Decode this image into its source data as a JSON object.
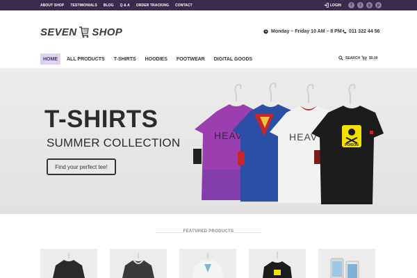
{
  "topbar": {
    "links": [
      "ABOUT SHOP",
      "TESTIMONIALS",
      "BLOG",
      "Q & A",
      "ORDER TRACKING",
      "CONTACT"
    ],
    "login_label": "LOGIN",
    "social": [
      {
        "icon": "facebook-icon",
        "glyph": "f"
      },
      {
        "icon": "twitter-icon",
        "glyph": "t"
      },
      {
        "icon": "google-plus-icon",
        "glyph": "g"
      },
      {
        "icon": "pinterest-icon",
        "glyph": "p"
      }
    ]
  },
  "header": {
    "logo_left": "SEVEN",
    "logo_right": "SHOP",
    "hours": "Monday – Friday 10 AM – 8 PM",
    "phone": "011 322 44 56"
  },
  "nav": {
    "items": [
      "HOME",
      "ALL PRODUCTS",
      "T-SHIRTS",
      "HOODIES",
      "FOOTWEAR",
      "DIGITAL GOODS"
    ],
    "active_index": 0,
    "search_label": "SEARCH",
    "cart_total": "$0.00"
  },
  "hero": {
    "title": "T-SHIRTS",
    "subtitle": "SUMMER COLLECTION",
    "button_label": "Find your perfect tee!",
    "shirt_prints": [
      "HEAV",
      "HEAV",
      "POISON"
    ]
  },
  "featured": {
    "title": "FEATURED PRODUCTS"
  },
  "colors": {
    "topbar": "#3b2a4d",
    "accent": "#ded3ef",
    "purple_shirt": "#9b3fb0",
    "blue_shirt": "#2c4fa6",
    "white_shirt": "#f2f2f2",
    "black_shirt": "#1c1c1c"
  }
}
